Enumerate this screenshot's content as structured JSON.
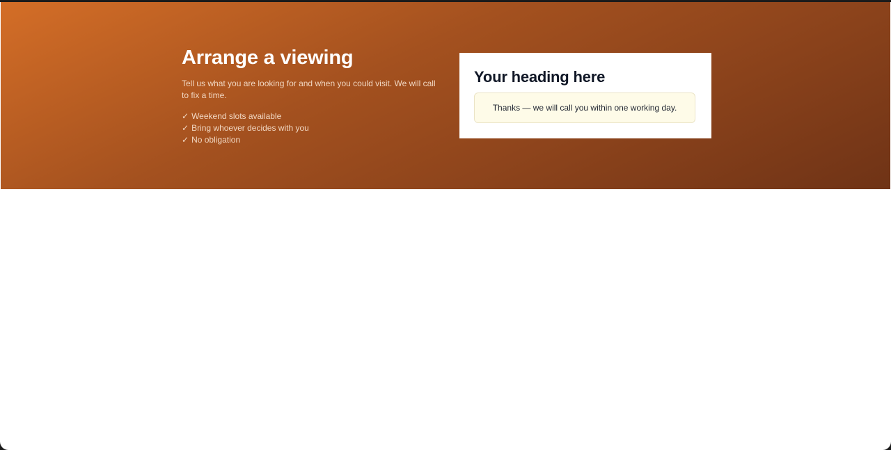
{
  "hero": {
    "title": "Arrange a viewing",
    "description": "Tell us what you are looking for and when you could visit. We will call to fix a time.",
    "check_glyph": "✓",
    "bullets": [
      "Weekend slots available",
      "Bring whoever decides with you",
      "No obligation"
    ]
  },
  "card": {
    "title": "Your heading here",
    "notice": "Thanks — we will call you within one working day."
  },
  "colors": {
    "hero_gradient_start": "#d46e27",
    "hero_gradient_end": "#6f3316",
    "notice_background": "#fefbe8",
    "heading_text": "#111827"
  }
}
